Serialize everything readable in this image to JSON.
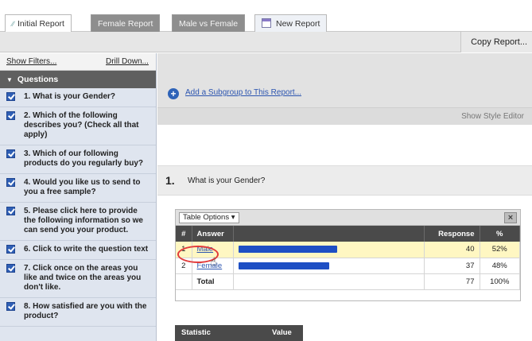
{
  "tabs": [
    {
      "label": "Initial Report",
      "icon": "chart-icon"
    },
    {
      "label": "Female Report"
    },
    {
      "label": "Male vs Female"
    },
    {
      "label": "New Report",
      "icon": "new-document-icon"
    }
  ],
  "toolbar": {
    "copy_label": "Copy Report..."
  },
  "sidebar": {
    "show_filters": "Show Filters...",
    "drill_down": "Drill Down...",
    "header": "Questions",
    "questions": [
      "1. What is your Gender?",
      "2. Which of the following describes you? (Check all that apply)",
      "3. Which of our following products do you regularly buy?",
      "4. Would you like us to send to you a free sample?",
      "5. Please click here to provide the following information so we can send you your product.",
      "6. Click to write the question text",
      "7. Click once on the areas you like and twice on the areas you don't like.",
      "8. How satisfied are you with the product?"
    ]
  },
  "main": {
    "add_subgroup": "Add a Subgroup to This Report...",
    "show_style_editor": "Show Style Editor",
    "question_number": "1.",
    "question_text": "What is your Gender?",
    "table_options": "Table Options",
    "table": {
      "headers": [
        "#",
        "Answer",
        "",
        "Response",
        "%"
      ],
      "rows": [
        {
          "num": "1",
          "answer": "Male",
          "bar_fraction": 0.52,
          "response": "40",
          "pct": "52%"
        },
        {
          "num": "2",
          "answer": "Female",
          "bar_fraction": 0.48,
          "response": "37",
          "pct": "48%"
        }
      ],
      "total": {
        "label": "Total",
        "response": "77",
        "pct": "100%"
      }
    },
    "stat_headers": [
      "Statistic",
      "Value"
    ]
  },
  "colors": {
    "bar": "#1e4fc4",
    "highlight_row": "#fff7c2",
    "link": "#2c55b0",
    "annotation_circle": "#e23a3a"
  }
}
